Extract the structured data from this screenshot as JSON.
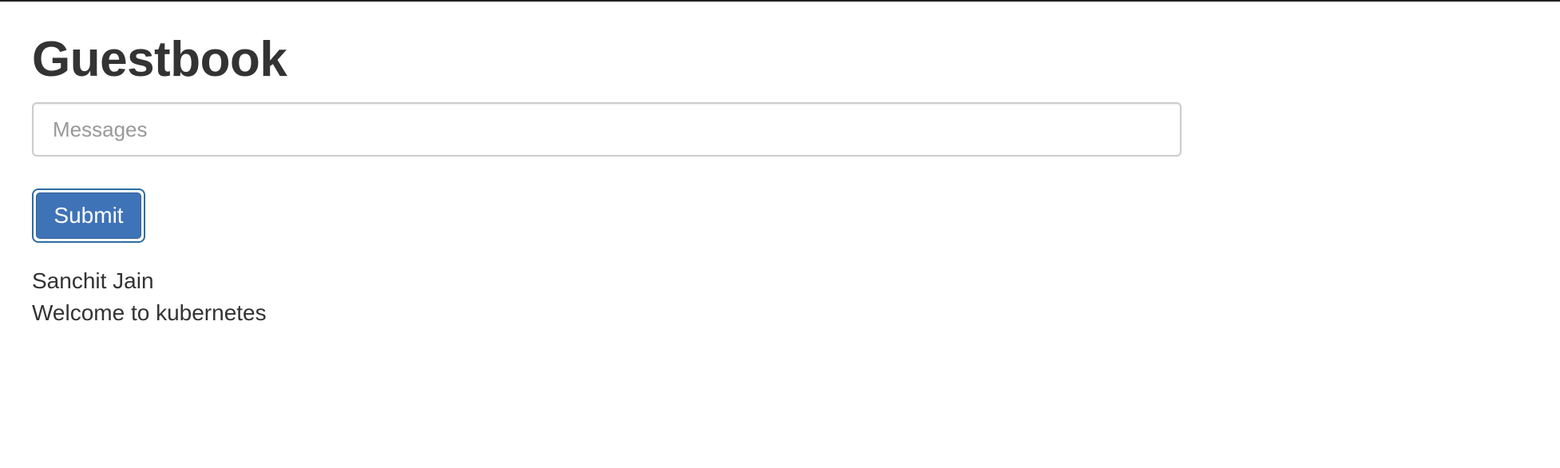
{
  "page": {
    "title": "Guestbook"
  },
  "form": {
    "message_placeholder": "Messages",
    "message_value": "",
    "submit_label": "Submit"
  },
  "entries": [
    "Sanchit Jain",
    "Welcome to kubernetes"
  ],
  "colors": {
    "primary_button": "#3f73b7",
    "text": "#333333"
  }
}
